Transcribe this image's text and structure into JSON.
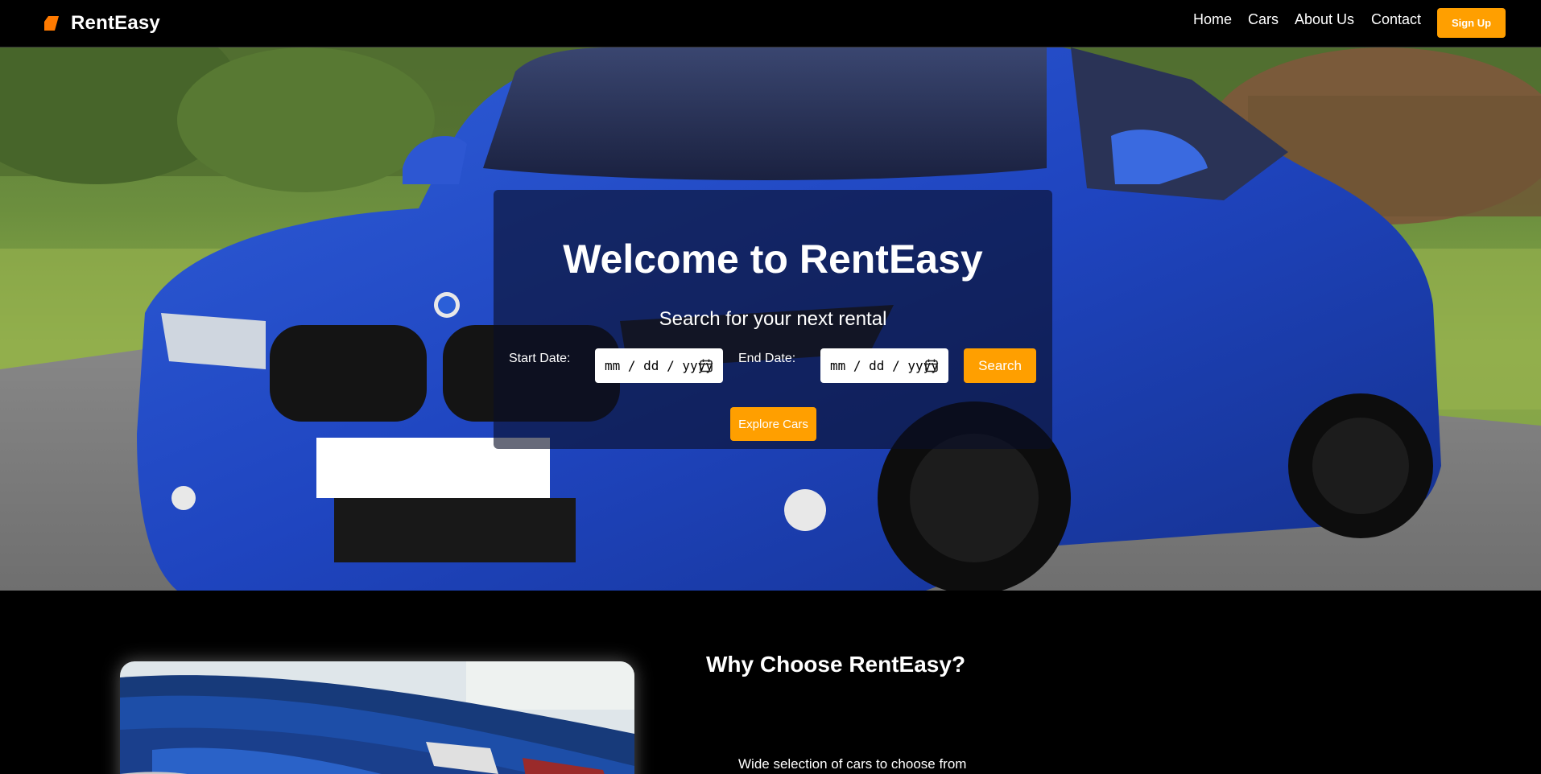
{
  "navbar": {
    "brand": "RentEasy",
    "brand_icon": "tag-icon",
    "links": [
      "Home",
      "Cars",
      "About Us",
      "Contact"
    ],
    "signup_label": "Sign Up",
    "accent_color": "#ff9f00"
  },
  "hero": {
    "title": "Welcome to RentEasy",
    "subtitle": "Search for your next rental",
    "start_label": "Start Date:",
    "start_placeholder": "mm / dd / yyyy",
    "end_label": "End Date:",
    "end_placeholder": "mm / dd / yyyy",
    "search_label": "Search",
    "explore_label": "Explore Cars"
  },
  "why": {
    "title": "Why Choose RentEasy?",
    "items": [
      "Wide selection of cars to choose from"
    ]
  }
}
